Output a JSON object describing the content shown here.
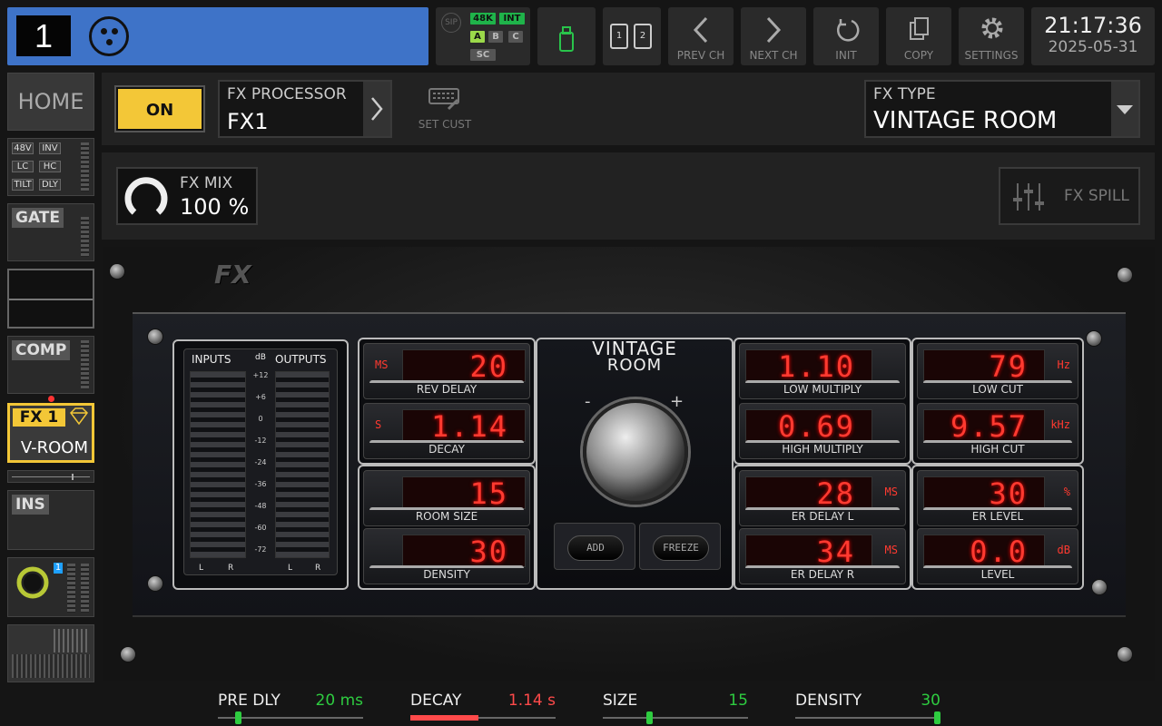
{
  "channel": {
    "number": "1"
  },
  "status": {
    "sip": "SIP",
    "rate": "48K",
    "clock": "INT",
    "a": "A",
    "b": "B",
    "c": "C",
    "sc": "SC"
  },
  "toolbar": {
    "prev": "PREV CH",
    "next": "NEXT CH",
    "init": "INIT",
    "copy": "COPY",
    "settings": "SETTINGS",
    "card1": "1",
    "card2": "2"
  },
  "clock": {
    "time": "21:17:36",
    "date": "2025-05-31"
  },
  "fx": {
    "on": "ON",
    "proc_label": "FX PROCESSOR",
    "proc_value": "FX1",
    "set_cust": "SET CUST",
    "type_label": "FX TYPE",
    "type_value": "VINTAGE ROOM",
    "mix_label": "FX MIX",
    "mix_value": "100 %",
    "spill": "FX SPILL"
  },
  "sidebar": {
    "home": "HOME",
    "t48v": "48V",
    "inv": "INV",
    "lc": "LC",
    "hc": "HC",
    "tilt": "TILT",
    "dly": "DLY",
    "gate": "GATE",
    "comp": "COMP",
    "fx_tag": "FX 1",
    "fx_name": "V-ROOM",
    "ins": "INS",
    "bus": "1"
  },
  "rack": {
    "logo": "FX",
    "title1": "VINTAGE",
    "title2": "ROOM",
    "minus": "-",
    "plus": "+",
    "add": "ADD",
    "freeze": "FREEZE",
    "meters": {
      "in": "INPUTS",
      "out": "OUTPUTS",
      "db": "dB",
      "scale": [
        "+12",
        "+6",
        "0",
        "-12",
        "-24",
        "-36",
        "-48",
        "-60",
        "-72"
      ],
      "l": "L",
      "r": "R"
    },
    "params": [
      {
        "label": "REV DELAY",
        "value": "20",
        "unit": "MS"
      },
      {
        "label": "DECAY",
        "value": "1.14",
        "unit": "S"
      },
      {
        "label": "ROOM SIZE",
        "value": "15",
        "unit": ""
      },
      {
        "label": "DENSITY",
        "value": "30",
        "unit": ""
      },
      {
        "label": "LOW MULTIPLY",
        "value": "1.10",
        "unit": ""
      },
      {
        "label": "HIGH MULTIPLY",
        "value": "0.69",
        "unit": ""
      },
      {
        "label": "ER DELAY L",
        "value": "28",
        "unit": "MS"
      },
      {
        "label": "ER DELAY R",
        "value": "34",
        "unit": "MS"
      },
      {
        "label": "LOW CUT",
        "value": "79",
        "unit": "Hz"
      },
      {
        "label": "HIGH CUT",
        "value": "9.57",
        "unit": "kHz"
      },
      {
        "label": "ER LEVEL",
        "value": "30",
        "unit": "%"
      },
      {
        "label": "LEVEL",
        "value": "0.0",
        "unit": "dB"
      }
    ]
  },
  "bottom": [
    {
      "label": "PRE DLY",
      "value": "20 ms",
      "color": "#2ecc40",
      "level": 0.12
    },
    {
      "label": "DECAY",
      "value": "1.14 s",
      "color": "#ff4a4a",
      "level": 0.47
    },
    {
      "label": "SIZE",
      "value": "15",
      "color": "#2ecc40",
      "level": 0.3
    },
    {
      "label": "DENSITY",
      "value": "30",
      "color": "#2ecc40",
      "level": 1.0
    }
  ]
}
